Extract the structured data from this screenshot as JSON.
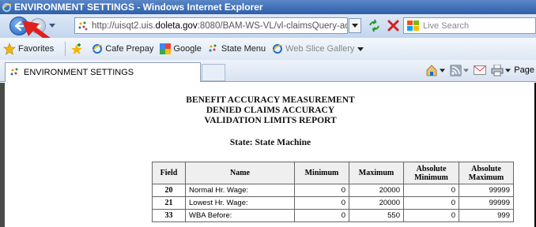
{
  "window": {
    "title": "ENVIRONMENT SETTINGS - Windows Internet Explorer"
  },
  "navbar": {
    "url_prefix": "http://uisqt2.uis.",
    "url_domain": "doleta.gov",
    "url_rest": ":8080/BAM-WS-VL/vl-claimsQuery-actic",
    "search_placeholder": "Live Search"
  },
  "favorites": {
    "favorites_label": "Favorites",
    "items": [
      {
        "label": "Cafe Prepay"
      },
      {
        "label": "Google"
      },
      {
        "label": "State Menu"
      },
      {
        "label": "Web Slice Gallery"
      }
    ]
  },
  "tabs": {
    "active_label": "ENVIRONMENT SETTINGS",
    "page_label": "Page"
  },
  "report": {
    "line1": "BENEFIT ACCURACY MEASUREMENT",
    "line2": "DENIED CLAIMS ACCURACY",
    "line3": "VALIDATION LIMITS REPORT",
    "state_line": "State: State Machine",
    "columns": [
      "Field",
      "Name",
      "Minimum",
      "Maximum",
      "Absolute Minimum",
      "Absolute Maximum"
    ],
    "rows": [
      {
        "field": "20",
        "name": "Normal Hr. Wage:",
        "min": "0",
        "max": "20000",
        "amin": "0",
        "amax": "99999"
      },
      {
        "field": "21",
        "name": "Lowest Hr. Wage:",
        "min": "0",
        "max": "20000",
        "amin": "0",
        "amax": "99999"
      },
      {
        "field": "33",
        "name": "WBA Before:",
        "min": "0",
        "max": "550",
        "amin": "0",
        "amax": "999"
      }
    ]
  },
  "colors": {
    "titlebar": "#2f5fa8",
    "callout_arrow": "#e0201b"
  }
}
